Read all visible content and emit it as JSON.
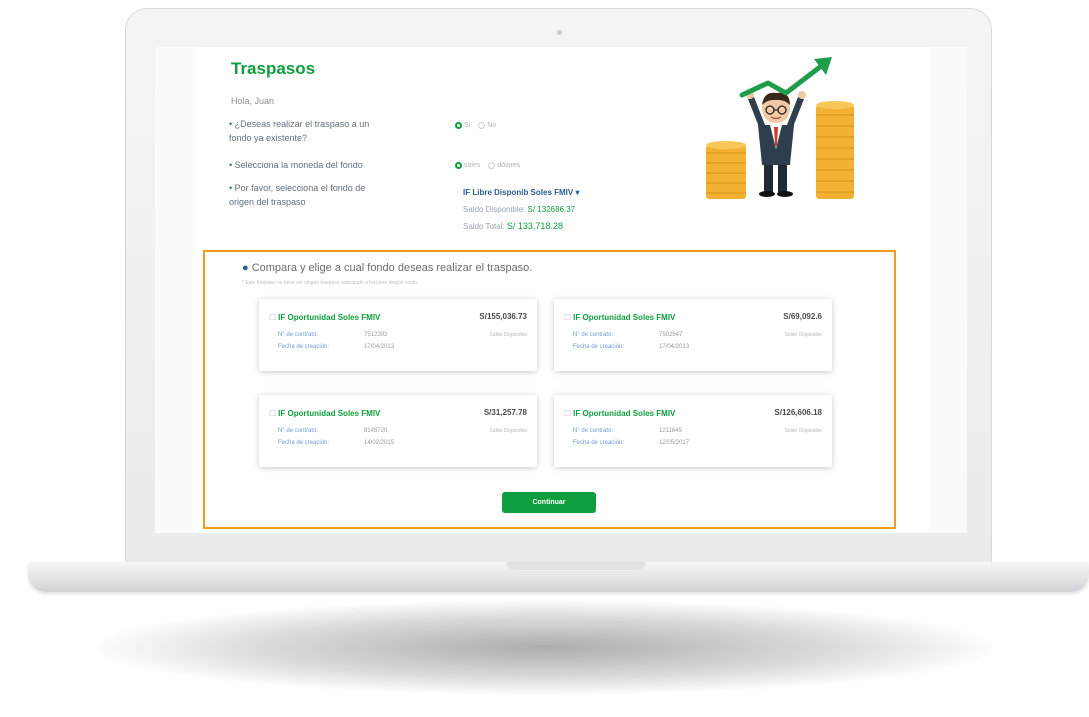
{
  "app": {
    "title": "Traspasos",
    "greeting": "Hola, Juan"
  },
  "questions": [
    {
      "line1": "¿Deseas realizar el traspaso a un",
      "line2": "fondo ya existente?",
      "options": [
        "Si",
        "No"
      ],
      "selected": "Si"
    },
    {
      "line1": "Selecciona la moneda del fondo",
      "options": [
        "soles",
        "dólares"
      ],
      "selected": "soles"
    },
    {
      "line1": "Por favor, selecciona el fondo de",
      "line2": "origen del traspaso"
    }
  ],
  "origin_fund": {
    "name": "IF Libre Disponib Soles FMIV",
    "available_label": "Saldo Disponible:",
    "available_value": "S/ 132686.37",
    "total_label": "Saldo Total:",
    "total_value": "S/ 133,718.28"
  },
  "compare": {
    "title": "Compara y elige a cual fondo deseas realizar el traspaso.",
    "note": "* Este traspaso se tiene sin ningún traspaso anticipado a ha tiene ningún costo.",
    "cards": [
      {
        "name": "IF Oportunidad Soles FMIV",
        "amount": "S/155,036.73",
        "amount_label": "Saldo Disponible",
        "contract_label": "N° de contrato:",
        "contract_value": "7512393",
        "date_label": "Fecha de creación:",
        "date_value": "17/04/2013"
      },
      {
        "name": "IF Oportunidad Soles FMIV",
        "amount": "S/69,092.6",
        "amount_label": "Saldo Disponible",
        "contract_label": "N° de contrato:",
        "contract_value": "7502647",
        "date_label": "Fecha de creación:",
        "date_value": "17/04/2013"
      },
      {
        "name": "IF Oportunidad Soles FMIV",
        "amount": "S/31,257.78",
        "amount_label": "Saldo Disponible",
        "contract_label": "N° de contrato:",
        "contract_value": "8145720",
        "date_label": "Fecha de creación:",
        "date_value": "14/02/2015"
      },
      {
        "name": "IF Oportunidad Soles FMIV",
        "amount": "S/126,606.18",
        "amount_label": "Saldo Disponible",
        "contract_label": "N° de contrato:",
        "contract_value": "1211645",
        "date_label": "Fecha de creación:",
        "date_value": "12/05/2017"
      }
    ],
    "continue_label": "Continuar"
  },
  "colors": {
    "brand_green": "#0e9e3d",
    "highlight_orange": "#f39a22",
    "link_blue": "#2c5d92"
  }
}
